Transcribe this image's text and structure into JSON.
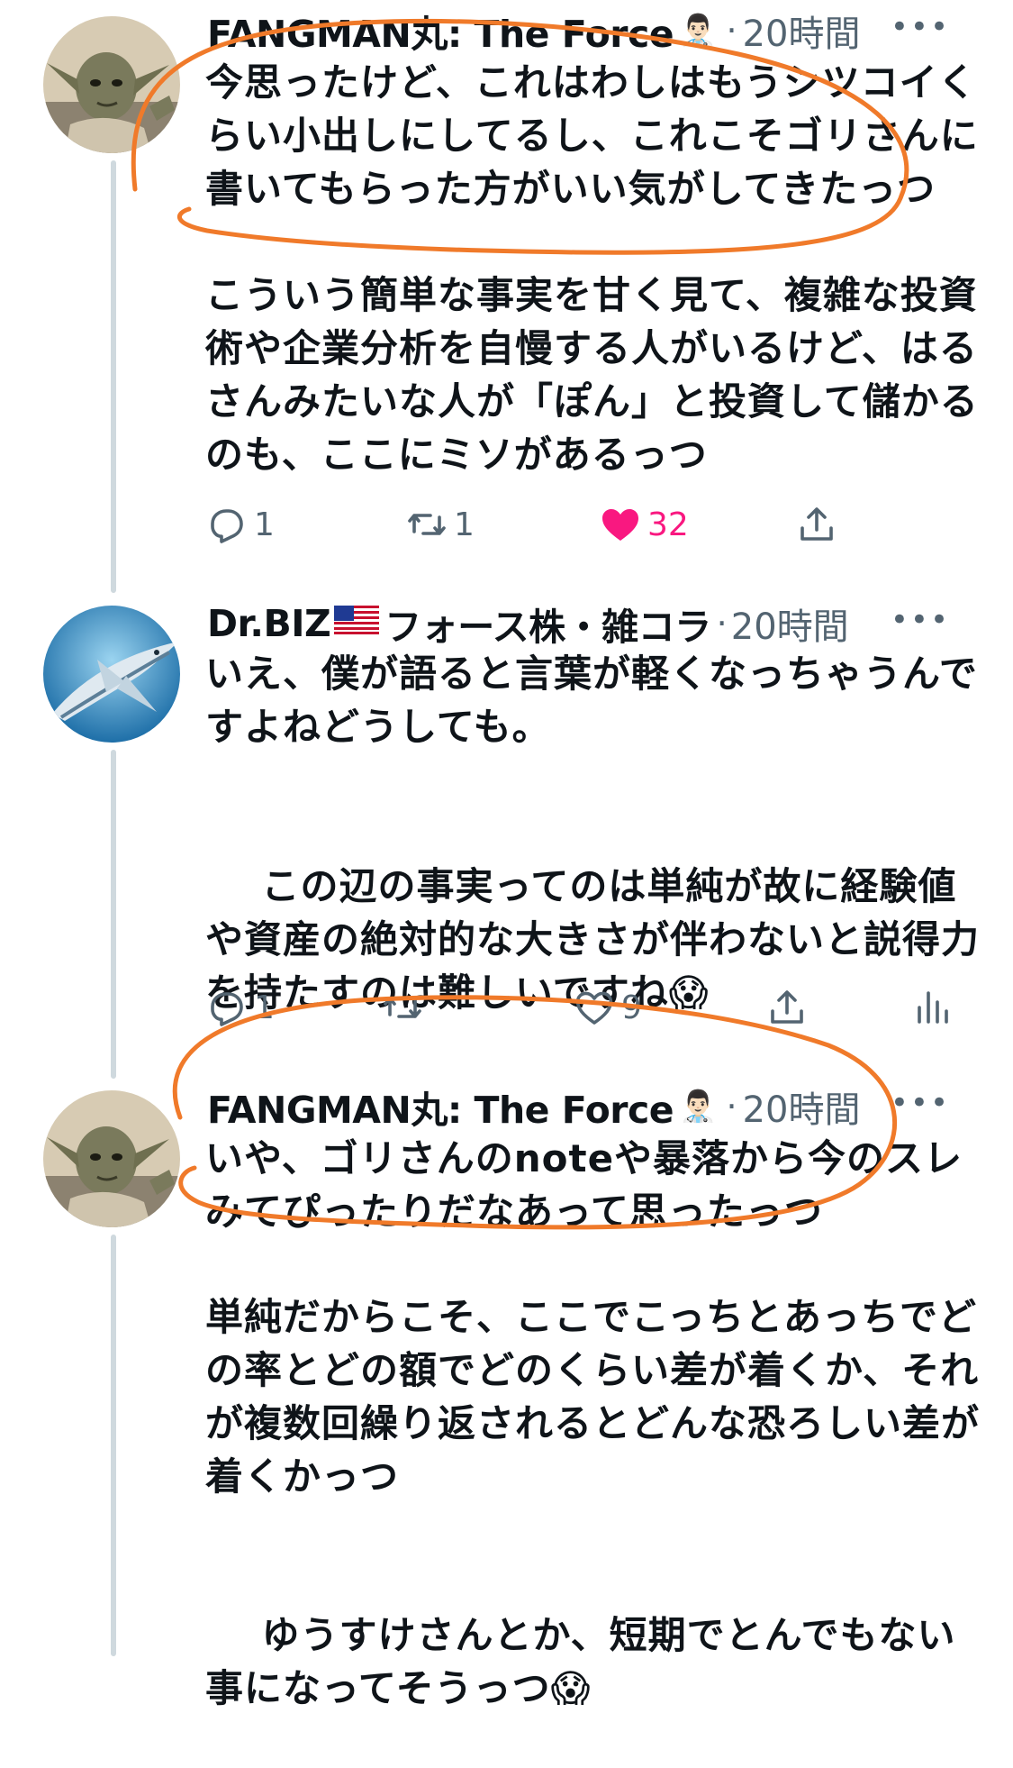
{
  "tweets": [
    {
      "author": "FANGMAN丸: The Force",
      "time": "20時間",
      "para1": "今思ったけど、これはわしはもうシツコイくらい小出しにしてるし、これこそゴリさんに書いてもらった方がいい気がしてきたっつ",
      "para2": "こういう簡単な事実を甘く見て、複雑な投資術や企業分析を自慢する人がいるけど、はるさんみたいな人が「ぽん」と投資して儲かるのも、ここにミソがあるっつ",
      "replies": "1",
      "retweets": "1",
      "likes": "32"
    },
    {
      "author": "Dr.BIZ",
      "author_suffix": "フォース株・雑コラ",
      "time": "20時間",
      "para1": "いえ、僕が語ると言葉が軽くなっちゃうんですよねどうしても。",
      "para2": "この辺の事実ってのは単純が故に経験値や資産の絶対的な大きさが伴わないと説得力を持たすのは難しいですね",
      "replies": "1",
      "likes": "9"
    },
    {
      "author": "FANGMAN丸: The Force",
      "time": "20時間",
      "para1": "いや、ゴリさんのnoteや暴落から今のスレみてぴったりだなあって思ったっつ",
      "para2": "単純だからこそ、ここでこっちとあっちでどの率とどの額でどのくらい差が着くか、それが複数回繰り返されるとどんな恐ろしい差が着くかっつ",
      "para3": "ゆうすけさんとか、短期でとんでもない事になってそうっつ"
    }
  ],
  "separator_dot": "·",
  "more_glyph": "•••",
  "icons": {
    "reply": "speech-bubble",
    "retweet": "retweet-arrows",
    "like": "heart",
    "share": "share-upload",
    "analytics": "bar-chart"
  },
  "colors": {
    "text": "#0f1419",
    "muted": "#536471",
    "like": "#f91880",
    "annotation": "#f07a2a",
    "thread_line": "#cfd9de"
  }
}
